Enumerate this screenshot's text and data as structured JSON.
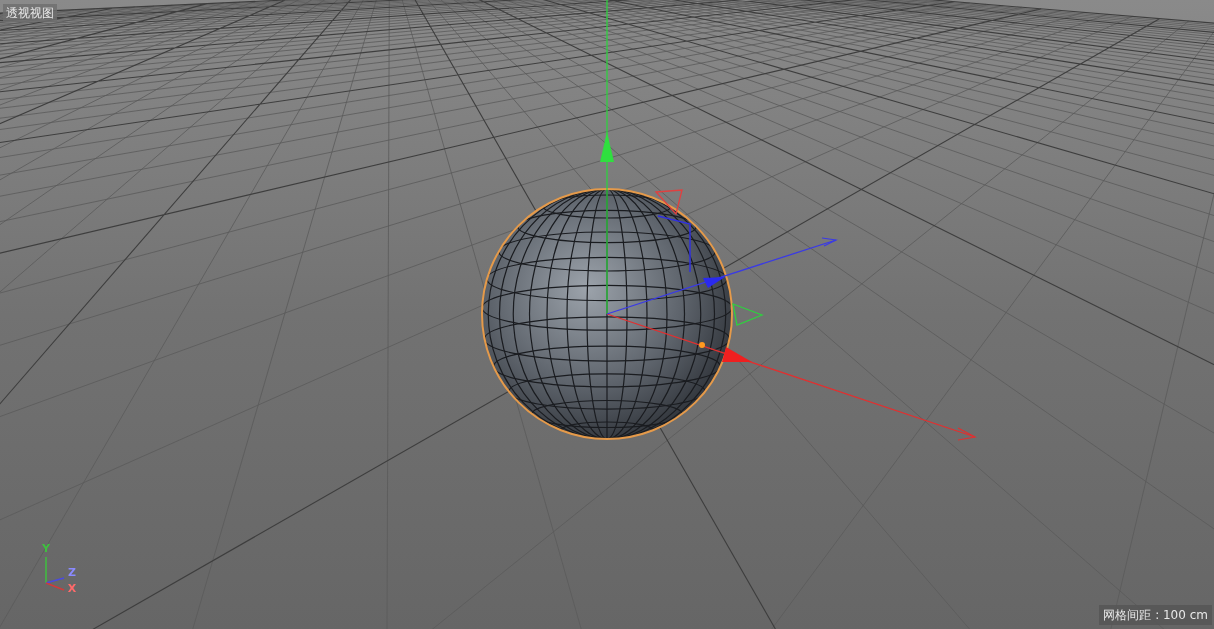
{
  "viewport": {
    "title": "透视视图",
    "grid_spacing": "网格间距 : 100 cm"
  },
  "axis_indicator": {
    "labels": [
      {
        "text": "Y",
        "color": "#3fbf3f"
      },
      {
        "text": "Z",
        "color": "#8a8aff"
      },
      {
        "text": "X",
        "color": "#ff6a6a"
      }
    ]
  }
}
